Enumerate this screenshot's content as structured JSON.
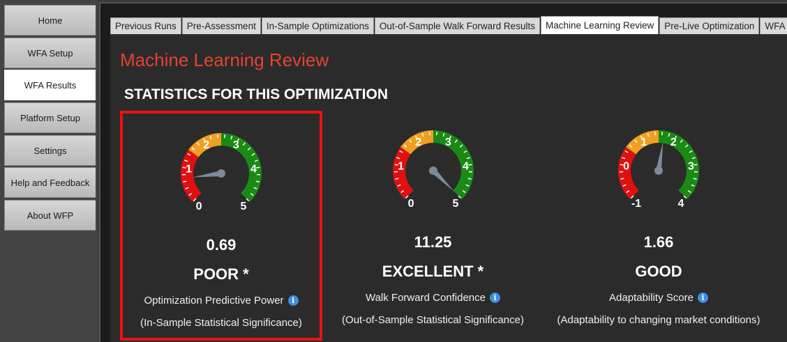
{
  "sidebar": {
    "items": [
      "Home",
      "WFA Setup",
      "WFA Results",
      "Platform Setup",
      "Settings",
      "Help and Feedback",
      "About WFP"
    ],
    "active_index": 2
  },
  "tabs": {
    "items": [
      "Previous Runs",
      "Pre-Assessment",
      "In-Sample Optimizations",
      "Out-of-Sample Walk Forward Results",
      "Machine Learning Review",
      "Pre-Live Optimization",
      "WFA"
    ],
    "active_index": 4
  },
  "page_title": "Machine Learning Review",
  "section_title": "STATISTICS FOR THIS OPTIMIZATION",
  "stats": [
    {
      "value": "0.69",
      "rating": "POOR  *",
      "label": "Optimization Predictive Power",
      "sub": "(In-Sample Statistical Significance)",
      "gauge": {
        "min": 0,
        "max": 5,
        "ticks": [
          "0",
          "1",
          "2",
          "3",
          "4",
          "5"
        ],
        "reading": 0.69
      },
      "highlighted": true
    },
    {
      "value": "11.25",
      "rating": "EXCELLENT  *",
      "label": "Walk Forward Confidence",
      "sub": "(Out-of-Sample Statistical Significance)",
      "gauge": {
        "min": 0,
        "max": 5,
        "ticks": [
          "0",
          "1",
          "2",
          "3",
          "4",
          "5"
        ],
        "reading": 11.25
      },
      "highlighted": false
    },
    {
      "value": "1.66",
      "rating": "GOOD",
      "label": "Adaptability Score",
      "sub": "(Adaptability to changing market conditions)",
      "gauge": {
        "min": -1,
        "max": 4,
        "ticks": [
          "-1",
          "0",
          "1",
          "2",
          "3",
          "4"
        ],
        "reading": 1.66
      },
      "highlighted": false
    }
  ],
  "icons": {
    "info": "info-icon"
  },
  "colors": {
    "title": "#e5432f",
    "gauge_red": "#e01010",
    "gauge_orange": "#f0a020",
    "gauge_green": "#1a8a14",
    "needle": "#7d8a99",
    "highlight": "#ee1111"
  }
}
